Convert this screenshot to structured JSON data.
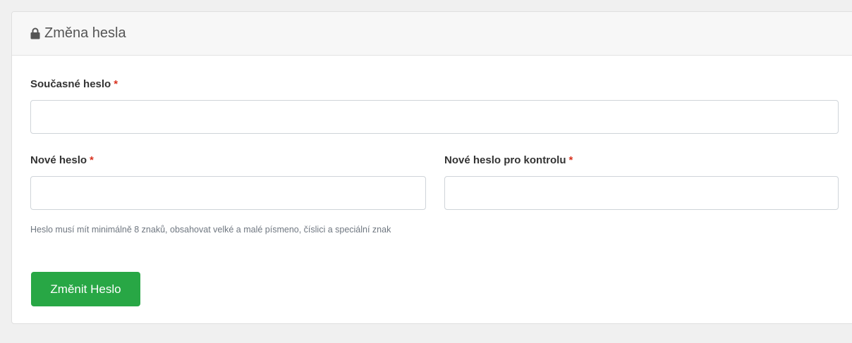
{
  "card": {
    "title": "Změna hesla",
    "icon": "lock-icon"
  },
  "form": {
    "current_password": {
      "label": "Současné heslo",
      "required_mark": "*",
      "value": ""
    },
    "new_password": {
      "label": "Nové heslo",
      "required_mark": "*",
      "value": "",
      "help": "Heslo musí mít minimálně 8 znaků, obsahovat velké a malé písmeno, číslici a speciální znak"
    },
    "confirm_password": {
      "label": "Nové heslo pro kontrolu",
      "required_mark": "*",
      "value": ""
    },
    "submit_label": "Změnit Heslo"
  },
  "colors": {
    "accent": "#28a745",
    "required": "#d9321f"
  }
}
